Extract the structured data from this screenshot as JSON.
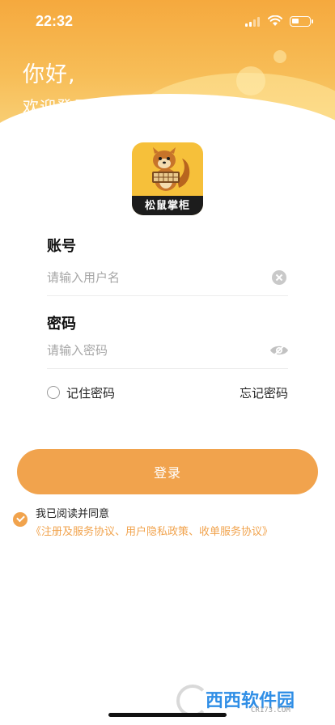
{
  "status_bar": {
    "time": "22:32"
  },
  "header": {
    "greeting": "你好,",
    "welcome": "欢迎登录松鼠掌柜!"
  },
  "logo": {
    "text": "松鼠掌柜"
  },
  "form": {
    "account_label": "账号",
    "account_placeholder": "请输入用户名",
    "password_label": "密码",
    "password_placeholder": "请输入密码",
    "remember_label": "记住密码",
    "remember_checked": false,
    "forgot_label": "忘记密码"
  },
  "login_button": {
    "label": "登录"
  },
  "agreement": {
    "checked": true,
    "text": "我已阅读并同意",
    "links": "《注册及服务协议、用户隐私政策、收单服务协议》"
  },
  "watermark": {
    "main": "西西软件园",
    "sub": "CR173.COM"
  },
  "colors": {
    "accent": "#f1a34d",
    "header_top": "#f5a93e",
    "header_bottom": "#f9d27a",
    "logo_bg": "#f6c03a"
  }
}
